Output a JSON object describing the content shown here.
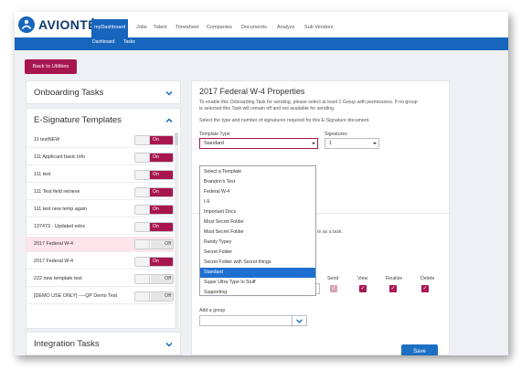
{
  "brand": {
    "name": "AVIONTÉ"
  },
  "nav": {
    "items": [
      "myDashboard",
      "Jobs",
      "Talent",
      "Timesheet",
      "Companies",
      "Documents",
      "Analyze",
      "Sub Vendors"
    ],
    "sub_items": [
      "Dashboard",
      "Tasks"
    ]
  },
  "back_button": "Back to Utilities",
  "left": {
    "onboarding_title": "Onboarding Tasks",
    "esign_title": "E-Signature Templates",
    "integration_title": "Integration Tasks",
    "templates": [
      {
        "name": "11 testNEW",
        "state": "On"
      },
      {
        "name": "111 Applicant basic info",
        "state": "On"
      },
      {
        "name": "111 test",
        "state": "On"
      },
      {
        "name": "111 Test field retrieve",
        "state": "On"
      },
      {
        "name": "111 test new temp again",
        "state": "On"
      },
      {
        "name": "137473 - Updated edoc",
        "state": "On"
      },
      {
        "name": "2017 Federal W-4",
        "state": "Off"
      },
      {
        "name": "2017 Federal W-4",
        "state": "On"
      },
      {
        "name": "222 new template test",
        "state": "Off"
      },
      {
        "name": "[DEMO USE ONLY] ----QP Demo Test",
        "state": "Off"
      }
    ]
  },
  "panel": {
    "title": "2017 Federal W-4 Properties",
    "desc_line1": "To enable this Onboarding Task for sending, please select at least 1 Group with permissions. If no group",
    "desc_line2": "is selected this Task will remain off and not available for sending.",
    "select_type_text": "Select the type and number of signatures required for this E-Signature document.",
    "template_type_label": "Template Type",
    "template_type_value": "Standard",
    "signatures_label": "Signatures",
    "signatures_value": "1",
    "dropdown_options": [
      "Select a Template",
      "Brandon's Test",
      "Federal W-4",
      "I-9",
      "Important Docs",
      "Most Secret Folder",
      "Most Secret Folder",
      "Randy Typey",
      "Secret Folder",
      "Secret Folder with Secret things",
      "Standard",
      "Super Ultra Type In Stuff",
      "Supporting"
    ],
    "highlighted_option": "Standard",
    "hidden_text_fragment": "te as a task.",
    "perm_headers": [
      "Send",
      "View",
      "Finalize",
      "Delete"
    ],
    "add_group_label": "Add a group",
    "save_label": "Save"
  }
}
